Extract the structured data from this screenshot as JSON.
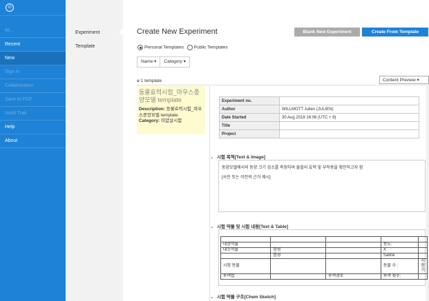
{
  "nav": {
    "logo": "⊙",
    "items": [
      {
        "label": "Mi…",
        "state": "dim"
      },
      {
        "label": "Recent",
        "state": "normal"
      },
      {
        "label": "New",
        "state": "active"
      },
      {
        "label": "Sign in",
        "state": "dim"
      },
      {
        "label": "Collaboration",
        "state": "dim"
      },
      {
        "label": "Save to PDF",
        "state": "dim"
      },
      {
        "label": "Audit Trail",
        "state": "dim"
      },
      {
        "label": "Help",
        "state": "normal"
      },
      {
        "label": "About",
        "state": "normal"
      }
    ]
  },
  "subnav": {
    "items": [
      "Experiment",
      "Template"
    ],
    "active": "Experiment"
  },
  "main": {
    "title": "Create New Experiment",
    "blank_button": "Blank New Experiment",
    "template_button": "Create From Template",
    "radio_personal": "Personal Templates",
    "radio_public": "Public Templates",
    "filter_name": "Name  ▾",
    "filter_category": "Category  ▾",
    "count": "⌀ 1 template",
    "preview_select": "Content Preview ▾"
  },
  "card": {
    "title": "동물효력시험_마우스종양모델 template",
    "desc_label": "Description:",
    "desc_value": "동물효력시험_마우스종양모델 template",
    "cat_label": "Category:",
    "cat_value": "미얍살시험"
  },
  "preview": {
    "meta": [
      {
        "key": "Experiment no.",
        "value": ""
      },
      {
        "key": "Author",
        "value": "WILLMOTT Julien (JULIEN)"
      },
      {
        "key": "Date Started",
        "value": "30 Aug 2018 16:08 (UTC + 9)"
      },
      {
        "key": "Title",
        "value": ""
      },
      {
        "key": "Project",
        "value": ""
      }
    ],
    "section1": {
      "title": "시험 목적[Text & Image]",
      "line1": "동양모델에서의 동양 크기 감소를 측정하여 물질의 효력 및 부작용을 확인하고자 함",
      "line2": "[사진 또는 이전의 근거 제시]"
    },
    "section2": {
      "title": "시험 약물 및 시험 내용[Text & Table]",
      "rows": [
        [
          "",
          "",
          "",
          "",
          ""
        ],
        [
          "대상약물",
          "",
          "",
          "농도:",
          ""
        ],
        [
          "대조약물",
          "양성",
          "",
          "X",
          ""
        ],
        [
          "",
          "음성",
          "",
          "Saline",
          ""
        ],
        [
          "시험 동물",
          "",
          "",
          "동물 수 :",
          "시험기"
        ],
        [
          "투여법",
          "",
          "투여경로",
          "투여 횟수:",
          ""
        ]
      ]
    },
    "section3": {
      "title": "시험 약물 구조[Chem Sketch]"
    }
  }
}
